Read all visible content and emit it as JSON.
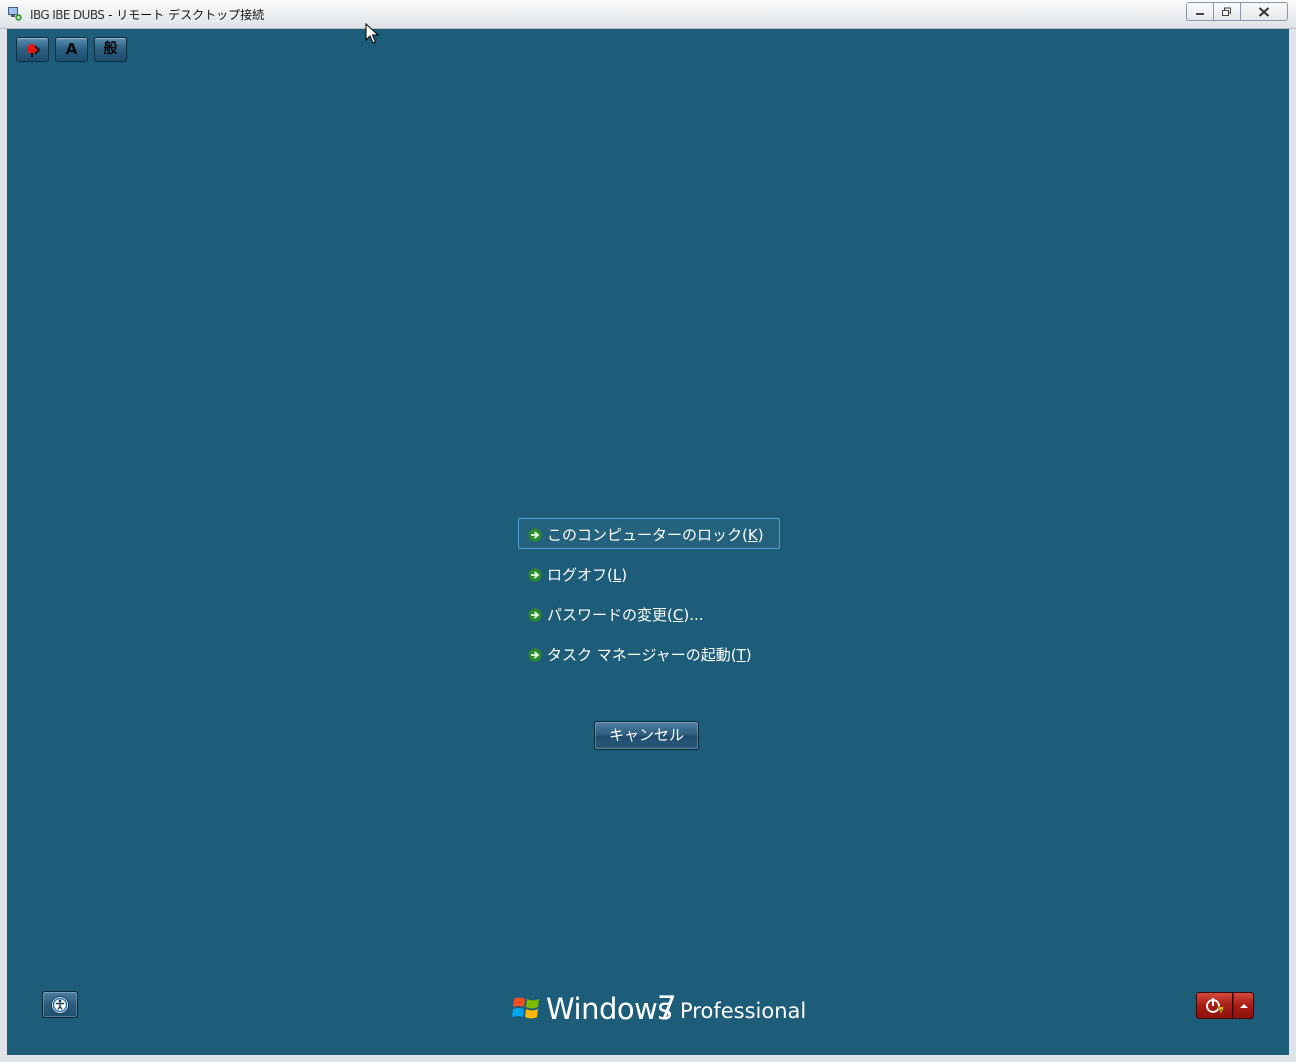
{
  "window": {
    "host_text": "IBG IBE DUBS",
    "separator": " - ",
    "app_title": "リモート デスクトップ接続"
  },
  "toolbar": {
    "ime_mode_label": "A",
    "ime_kanji_label": "般"
  },
  "options": [
    {
      "text": "このコンピューターのロック(",
      "key": "K",
      "suffix": ")"
    },
    {
      "text": "ログオフ(",
      "key": "L",
      "suffix": ")"
    },
    {
      "text": "パスワードの変更(",
      "key": "C",
      "suffix": ")..."
    },
    {
      "text": "タスク マネージャーの起動(",
      "key": "T",
      "suffix": ")"
    }
  ],
  "cancel_label": "キャンセル",
  "logo": {
    "windows": "Windows",
    "version": "7",
    "edition": "Professional"
  },
  "colors": {
    "desktop_bg": "#1e5d79",
    "focus_border": "#4fa0d6",
    "power_button": "#a81c14"
  },
  "icons": {
    "toolbar_1": "language-bar-icon",
    "ease_of_access": "ease-of-access-icon",
    "power": "shutdown-icon",
    "option_arrow": "green-arrow-icon"
  }
}
